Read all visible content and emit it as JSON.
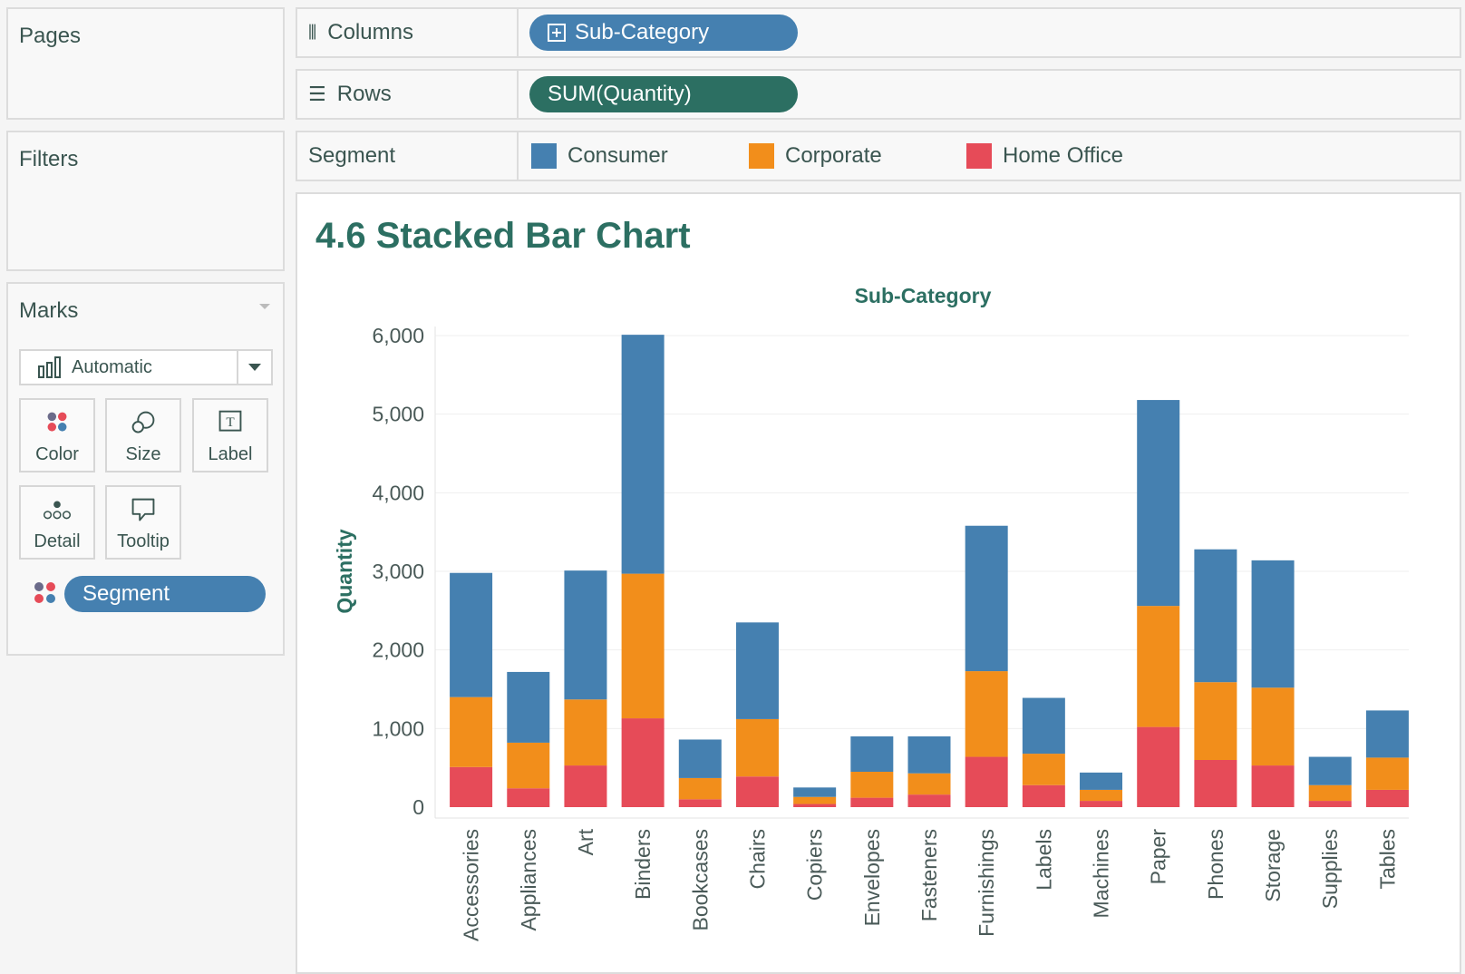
{
  "sidebar": {
    "pages_title": "Pages",
    "filters_title": "Filters",
    "marks_title": "Marks",
    "mark_type": "Automatic",
    "mark_buttons": [
      {
        "label": "Color",
        "icon": "color-dots-icon"
      },
      {
        "label": "Size",
        "icon": "size-circles-icon"
      },
      {
        "label": "Label",
        "icon": "label-text-icon"
      },
      {
        "label": "Detail",
        "icon": "detail-dots-icon"
      },
      {
        "label": "Tooltip",
        "icon": "tooltip-bubble-icon"
      }
    ],
    "segment_pill": "Segment"
  },
  "shelves": {
    "columns_label": "Columns",
    "columns_pill": "Sub-Category",
    "rows_label": "Rows",
    "rows_pill": "SUM(Quantity)",
    "segment_label": "Segment"
  },
  "legend": [
    {
      "name": "Consumer",
      "color": "#4580b0"
    },
    {
      "name": "Corporate",
      "color": "#f28e1b"
    },
    {
      "name": "Home Office",
      "color": "#e64b58"
    }
  ],
  "view": {
    "sheet_title": "4.6 Stacked Bar Chart"
  },
  "colors": {
    "accent_blue": "#4580b0",
    "accent_teal": "#2c6f62",
    "title_teal": "#2c6f62"
  },
  "chart_data": {
    "type": "bar",
    "stacked": true,
    "title": "Sub-Category",
    "xlabel": "",
    "ylabel": "Quantity",
    "ylim": [
      0,
      6000
    ],
    "yticks": [
      0,
      1000,
      2000,
      3000,
      4000,
      5000,
      6000
    ],
    "ytick_labels": [
      "0",
      "1,000",
      "2,000",
      "3,000",
      "4,000",
      "5,000",
      "6,000"
    ],
    "categories": [
      "Accessories",
      "Appliances",
      "Art",
      "Binders",
      "Bookcases",
      "Chairs",
      "Copiers",
      "Envelopes",
      "Fasteners",
      "Furnishings",
      "Labels",
      "Machines",
      "Paper",
      "Phones",
      "Storage",
      "Supplies",
      "Tables"
    ],
    "series": [
      {
        "name": "Home Office",
        "values": [
          510,
          240,
          530,
          1130,
          100,
          390,
          40,
          120,
          160,
          640,
          280,
          80,
          1020,
          600,
          530,
          80,
          220
        ]
      },
      {
        "name": "Corporate",
        "values": [
          890,
          580,
          840,
          1840,
          270,
          730,
          90,
          330,
          270,
          1090,
          400,
          140,
          1540,
          990,
          990,
          200,
          410
        ]
      },
      {
        "name": "Consumer",
        "values": [
          1580,
          900,
          1640,
          3040,
          490,
          1230,
          120,
          450,
          470,
          1850,
          710,
          220,
          2620,
          1690,
          1620,
          360,
          600
        ]
      }
    ],
    "grid": true,
    "legend_position": "top"
  }
}
